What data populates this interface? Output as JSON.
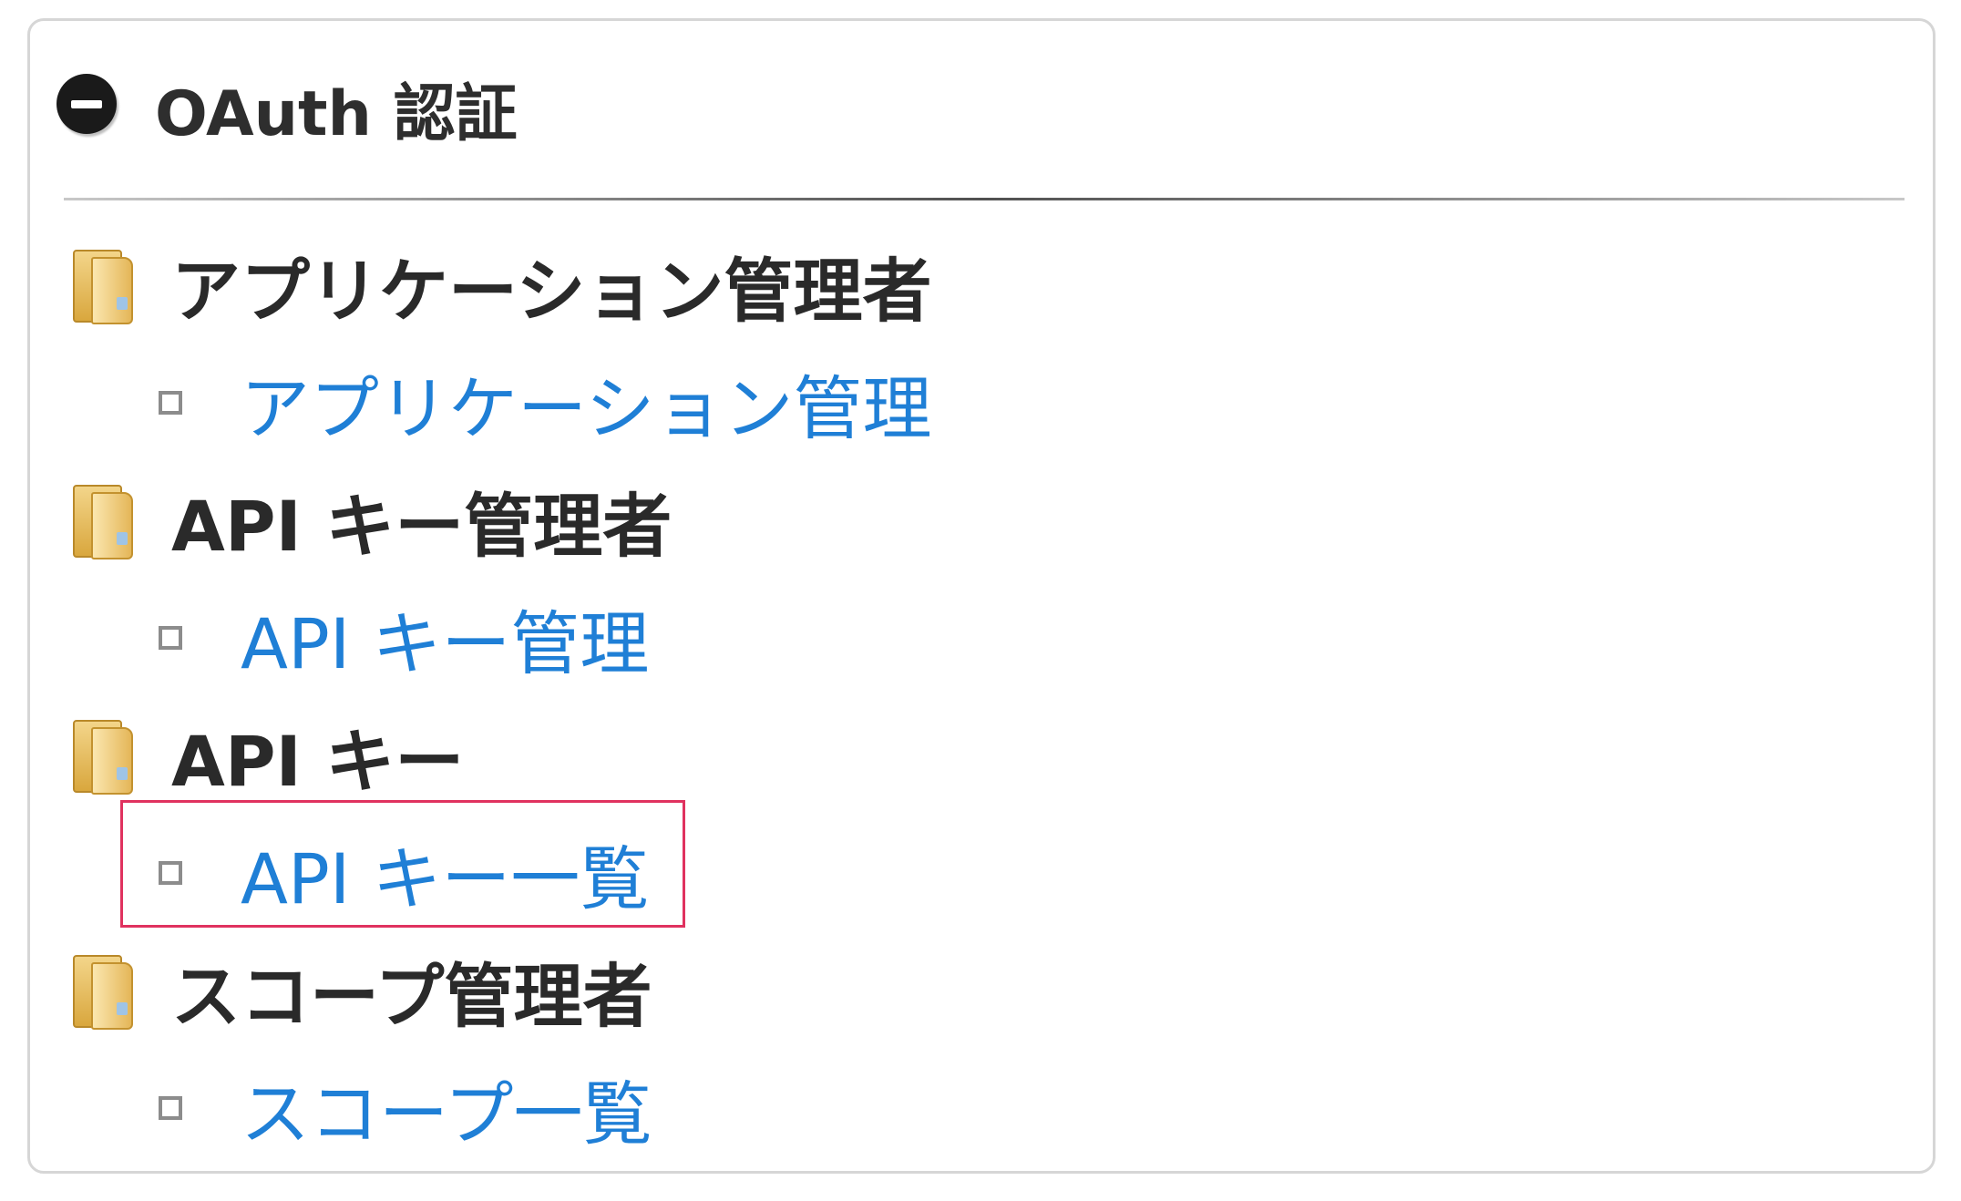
{
  "panel": {
    "title": "OAuth 認証",
    "collapse_icon": "minus-circle-icon"
  },
  "groups": [
    {
      "label": "アプリケーション管理者",
      "icon": "folder-icon",
      "items": [
        {
          "label": "アプリケーション管理",
          "icon": "square-bullet-icon"
        }
      ]
    },
    {
      "label": "API キー管理者",
      "icon": "folder-icon",
      "items": [
        {
          "label": "API キー管理",
          "icon": "square-bullet-icon"
        }
      ]
    },
    {
      "label": "API キー",
      "icon": "folder-icon",
      "items": [
        {
          "label": "API キー一覧",
          "icon": "square-bullet-icon",
          "highlighted": true
        }
      ]
    },
    {
      "label": "スコープ管理者",
      "icon": "folder-icon",
      "items": [
        {
          "label": "スコープ一覧",
          "icon": "square-bullet-icon"
        }
      ]
    }
  ],
  "colors": {
    "link": "#1f7fd6",
    "heading": "#2a2a2a",
    "highlight_border": "#e0325f",
    "panel_border": "#d6d6d6"
  }
}
